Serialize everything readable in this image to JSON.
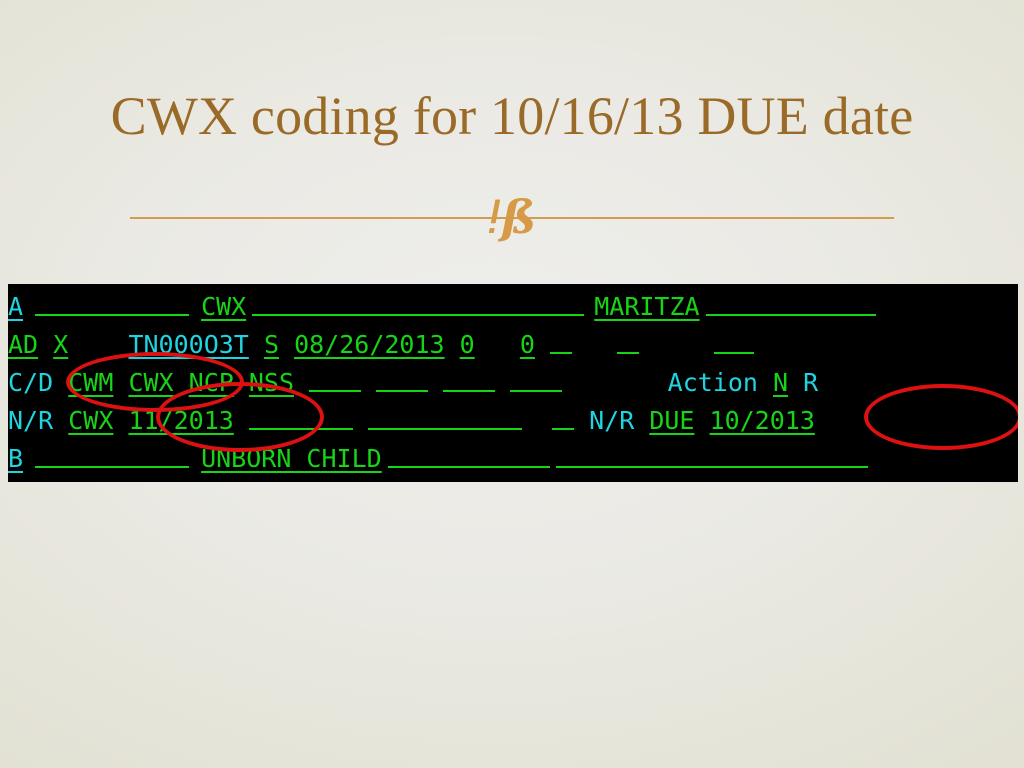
{
  "slide": {
    "title": "CWX coding for 10/16/13 DUE date",
    "title_color": "#9A6B28",
    "background_color": "#EBEAE5",
    "divider_color": "#D39A52",
    "divider_ornament": "ǃß"
  },
  "terminal": {
    "background_color": "#000000",
    "green_color": "#17D417",
    "cyan_color": "#1FD4E0",
    "annotation_color": "#DD1111",
    "rows": [
      {
        "id": "row-a",
        "cells": [
          {
            "text": "A",
            "color": "cyan",
            "underline": true
          },
          {
            "text": "",
            "color": "green",
            "underline": true,
            "blank_width": 154
          },
          {
            "text": "CWX",
            "color": "green",
            "underline": true
          },
          {
            "text": "",
            "color": "green",
            "underline": true,
            "blank_width": 332
          },
          {
            "text": "MARITZA",
            "color": "green",
            "underline": true
          },
          {
            "text": "",
            "color": "green",
            "underline": true,
            "blank_width": 170
          }
        ]
      },
      {
        "id": "row-ad",
        "cells": [
          {
            "text": "AD",
            "color": "green",
            "underline": true
          },
          {
            "text": "X",
            "color": "green",
            "underline": true
          },
          {
            "text": "TN000O3T",
            "color": "cyan",
            "underline": true
          },
          {
            "text": "S",
            "color": "green",
            "underline": true
          },
          {
            "text": "08/26/2013",
            "color": "green",
            "underline": true
          },
          {
            "text": "0",
            "color": "green",
            "underline": true
          },
          {
            "text": "0",
            "color": "green",
            "underline": true
          },
          {
            "text": "",
            "color": "green",
            "underline": true,
            "blank_width": 22
          },
          {
            "text": "",
            "color": "green",
            "underline": true,
            "blank_width": 22
          },
          {
            "text": "",
            "color": "green",
            "underline": true,
            "blank_width": 40
          }
        ]
      },
      {
        "id": "row-cd",
        "cells": [
          {
            "text": "C/D",
            "color": "cyan",
            "underline": false
          },
          {
            "text": "CWM",
            "color": "green",
            "underline": true
          },
          {
            "text": "CWX",
            "color": "green",
            "underline": true
          },
          {
            "text": "NCP",
            "color": "green",
            "underline": true
          },
          {
            "text": "NSS",
            "color": "green",
            "underline": true
          },
          {
            "text": "",
            "color": "green",
            "underline": true,
            "blank_width": 52
          },
          {
            "text": "",
            "color": "green",
            "underline": true,
            "blank_width": 52
          },
          {
            "text": "",
            "color": "green",
            "underline": true,
            "blank_width": 52
          },
          {
            "text": "",
            "color": "green",
            "underline": true,
            "blank_width": 52
          },
          {
            "text": "Action",
            "color": "cyan",
            "underline": false
          },
          {
            "text": "N",
            "color": "green",
            "underline": true
          },
          {
            "text": "R",
            "color": "cyan",
            "underline": false
          }
        ]
      },
      {
        "id": "row-nr",
        "cells": [
          {
            "text": "N/R",
            "color": "cyan",
            "underline": false
          },
          {
            "text": "CWX",
            "color": "green",
            "underline": true
          },
          {
            "text": "11/2013",
            "color": "green",
            "underline": true
          },
          {
            "text": "",
            "color": "green",
            "underline": true,
            "blank_width": 104
          },
          {
            "text": "",
            "color": "green",
            "underline": true,
            "blank_width": 154
          },
          {
            "text": "",
            "color": "green",
            "underline": true,
            "blank_width": 22
          },
          {
            "text": "N/R",
            "color": "cyan",
            "underline": false
          },
          {
            "text": "DUE",
            "color": "green",
            "underline": true
          },
          {
            "text": "10/2013",
            "color": "green",
            "underline": true
          }
        ]
      },
      {
        "id": "row-b",
        "cells": [
          {
            "text": "B",
            "color": "cyan",
            "underline": true
          },
          {
            "text": "",
            "color": "green",
            "underline": true,
            "blank_width": 154
          },
          {
            "text": "UNBORN CHILD",
            "color": "green",
            "underline": true
          },
          {
            "text": "",
            "color": "green",
            "underline": true,
            "blank_width": 162
          },
          {
            "text": "",
            "color": "green",
            "underline": true,
            "blank_width": 312
          }
        ]
      }
    ],
    "annotations": [
      {
        "id": "ellipse-cwm-cwx",
        "target": "CWM CWX"
      },
      {
        "id": "ellipse-nr-11-2013",
        "target": "11/2013"
      },
      {
        "id": "ellipse-due-10-2013",
        "target": "10/2013"
      }
    ]
  }
}
